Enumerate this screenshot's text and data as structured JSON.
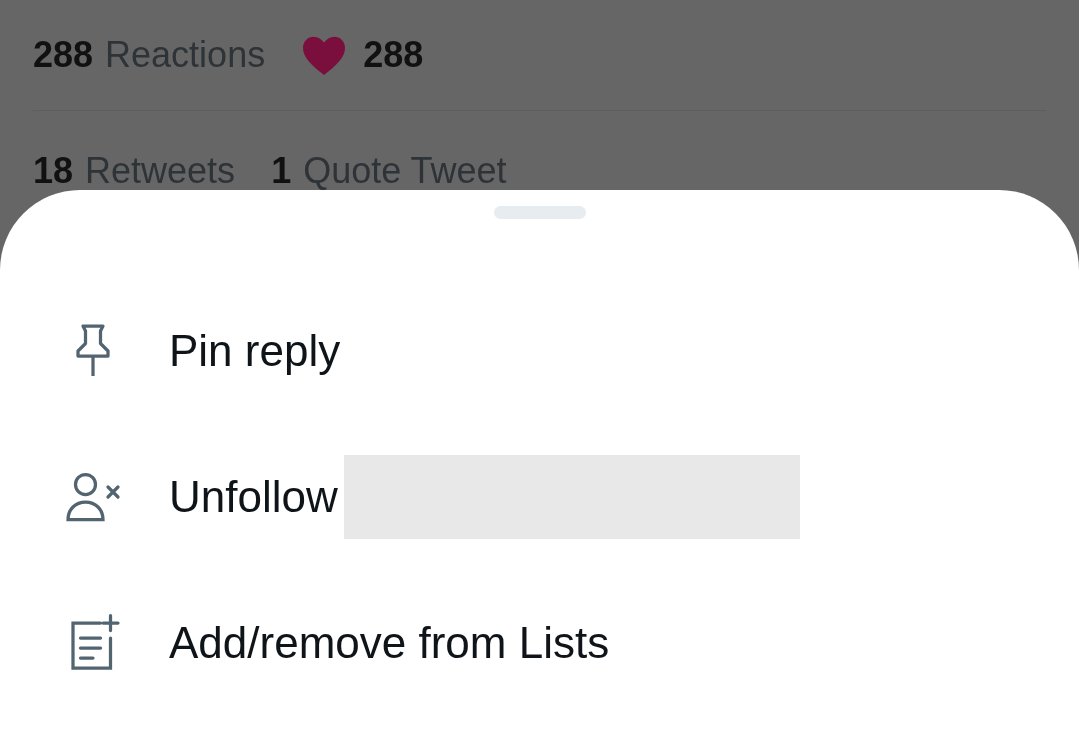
{
  "stats_top": [
    {
      "number": "288",
      "label": "Reactions"
    }
  ],
  "likes": {
    "count": "288"
  },
  "stats_bottom": [
    {
      "number": "18",
      "label": "Retweets"
    },
    {
      "number": "1",
      "label": "Quote Tweet"
    }
  ],
  "menu": [
    {
      "kind": "pin",
      "label": "Pin reply",
      "redacted": false
    },
    {
      "kind": "unfollow",
      "label": "Unfollow",
      "redacted": true
    },
    {
      "kind": "lists",
      "label": "Add/remove from Lists",
      "redacted": false
    }
  ]
}
